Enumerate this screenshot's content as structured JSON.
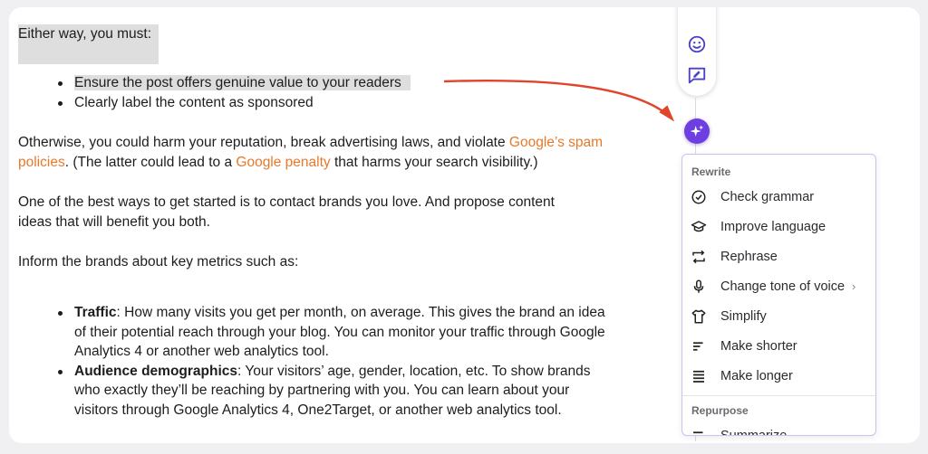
{
  "document": {
    "intro": "Either way, you must:",
    "must_list": [
      "Ensure the post offers genuine value to your readers",
      "Clearly label the content as sponsored"
    ],
    "otherwise_1": "Otherwise, you could harm your reputation, break advertising laws, and violate ",
    "otherwise_link1": "Google’s spam policies",
    "otherwise_2": ". (The latter could lead to a ",
    "otherwise_link2": "Google penalty",
    "otherwise_3": " that harms your search visibility.)",
    "brands": "One of the best ways to get started is to contact brands you love. And propose content ideas that will benefit you both.",
    "metrics_intro": "Inform the brands about key metrics such as:",
    "metrics": [
      {
        "term": "Traffic",
        "text": ": How many visits you get per month, on average. This gives the brand an idea of their potential reach through your blog. You can monitor your traffic through Google Analytics 4 or another web analytics tool."
      },
      {
        "term": "Audience demographics",
        "text": ": Your visitors’ age, gender, location, etc. To show brands who exactly they’ll be reaching by partnering with you. You can learn about your visitors through Google Analytics 4, One2Target, or another web analytics tool."
      }
    ]
  },
  "toolbar": {
    "icons": [
      "emoji-icon",
      "comment-edit-icon"
    ],
    "ai_icon": "sparkle-icon",
    "accent_color": "#6d3fe0"
  },
  "menu": {
    "rewrite_heading": "Rewrite",
    "items": [
      {
        "label": "Check grammar",
        "icon": "check-circle-icon"
      },
      {
        "label": "Improve language",
        "icon": "graduation-cap-icon"
      },
      {
        "label": "Rephrase",
        "icon": "repeat-icon"
      },
      {
        "label": "Change tone of voice",
        "icon": "microphone-icon",
        "submenu": true
      },
      {
        "label": "Simplify",
        "icon": "shirt-icon"
      },
      {
        "label": "Make shorter",
        "icon": "short-lines-icon"
      },
      {
        "label": "Make longer",
        "icon": "long-lines-icon"
      }
    ],
    "repurpose_heading": "Repurpose",
    "partial_item": "Summarize"
  },
  "annotation": {
    "arrow_color": "#e0452b"
  }
}
